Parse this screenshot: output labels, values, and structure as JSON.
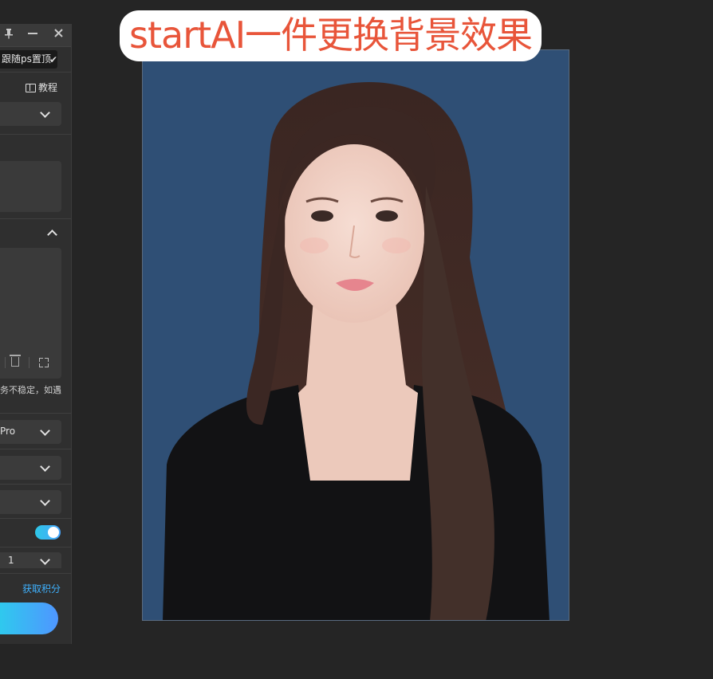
{
  "panel": {
    "tooltip": "跟随ps置顶",
    "tutorial_label": "教程",
    "note_text": "务不稳定，如遇",
    "model_dropdown_value": "Pro",
    "count_dropdown_value": "1",
    "credits_link": "获取积分",
    "toggle_on": true
  },
  "headline": "startAI一件更换背景效果",
  "colors": {
    "accent_gradient_start": "#2fc9ee",
    "accent_gradient_end": "#4f96ff",
    "headline_red": "#e8553a",
    "photo_background": "#2f4f75"
  },
  "icons": [
    "pin-icon",
    "minimize-icon",
    "close-icon",
    "check-icon",
    "book-icon",
    "chevron-down-icon",
    "chevron-up-icon",
    "trash-icon",
    "fullscreen-icon"
  ]
}
